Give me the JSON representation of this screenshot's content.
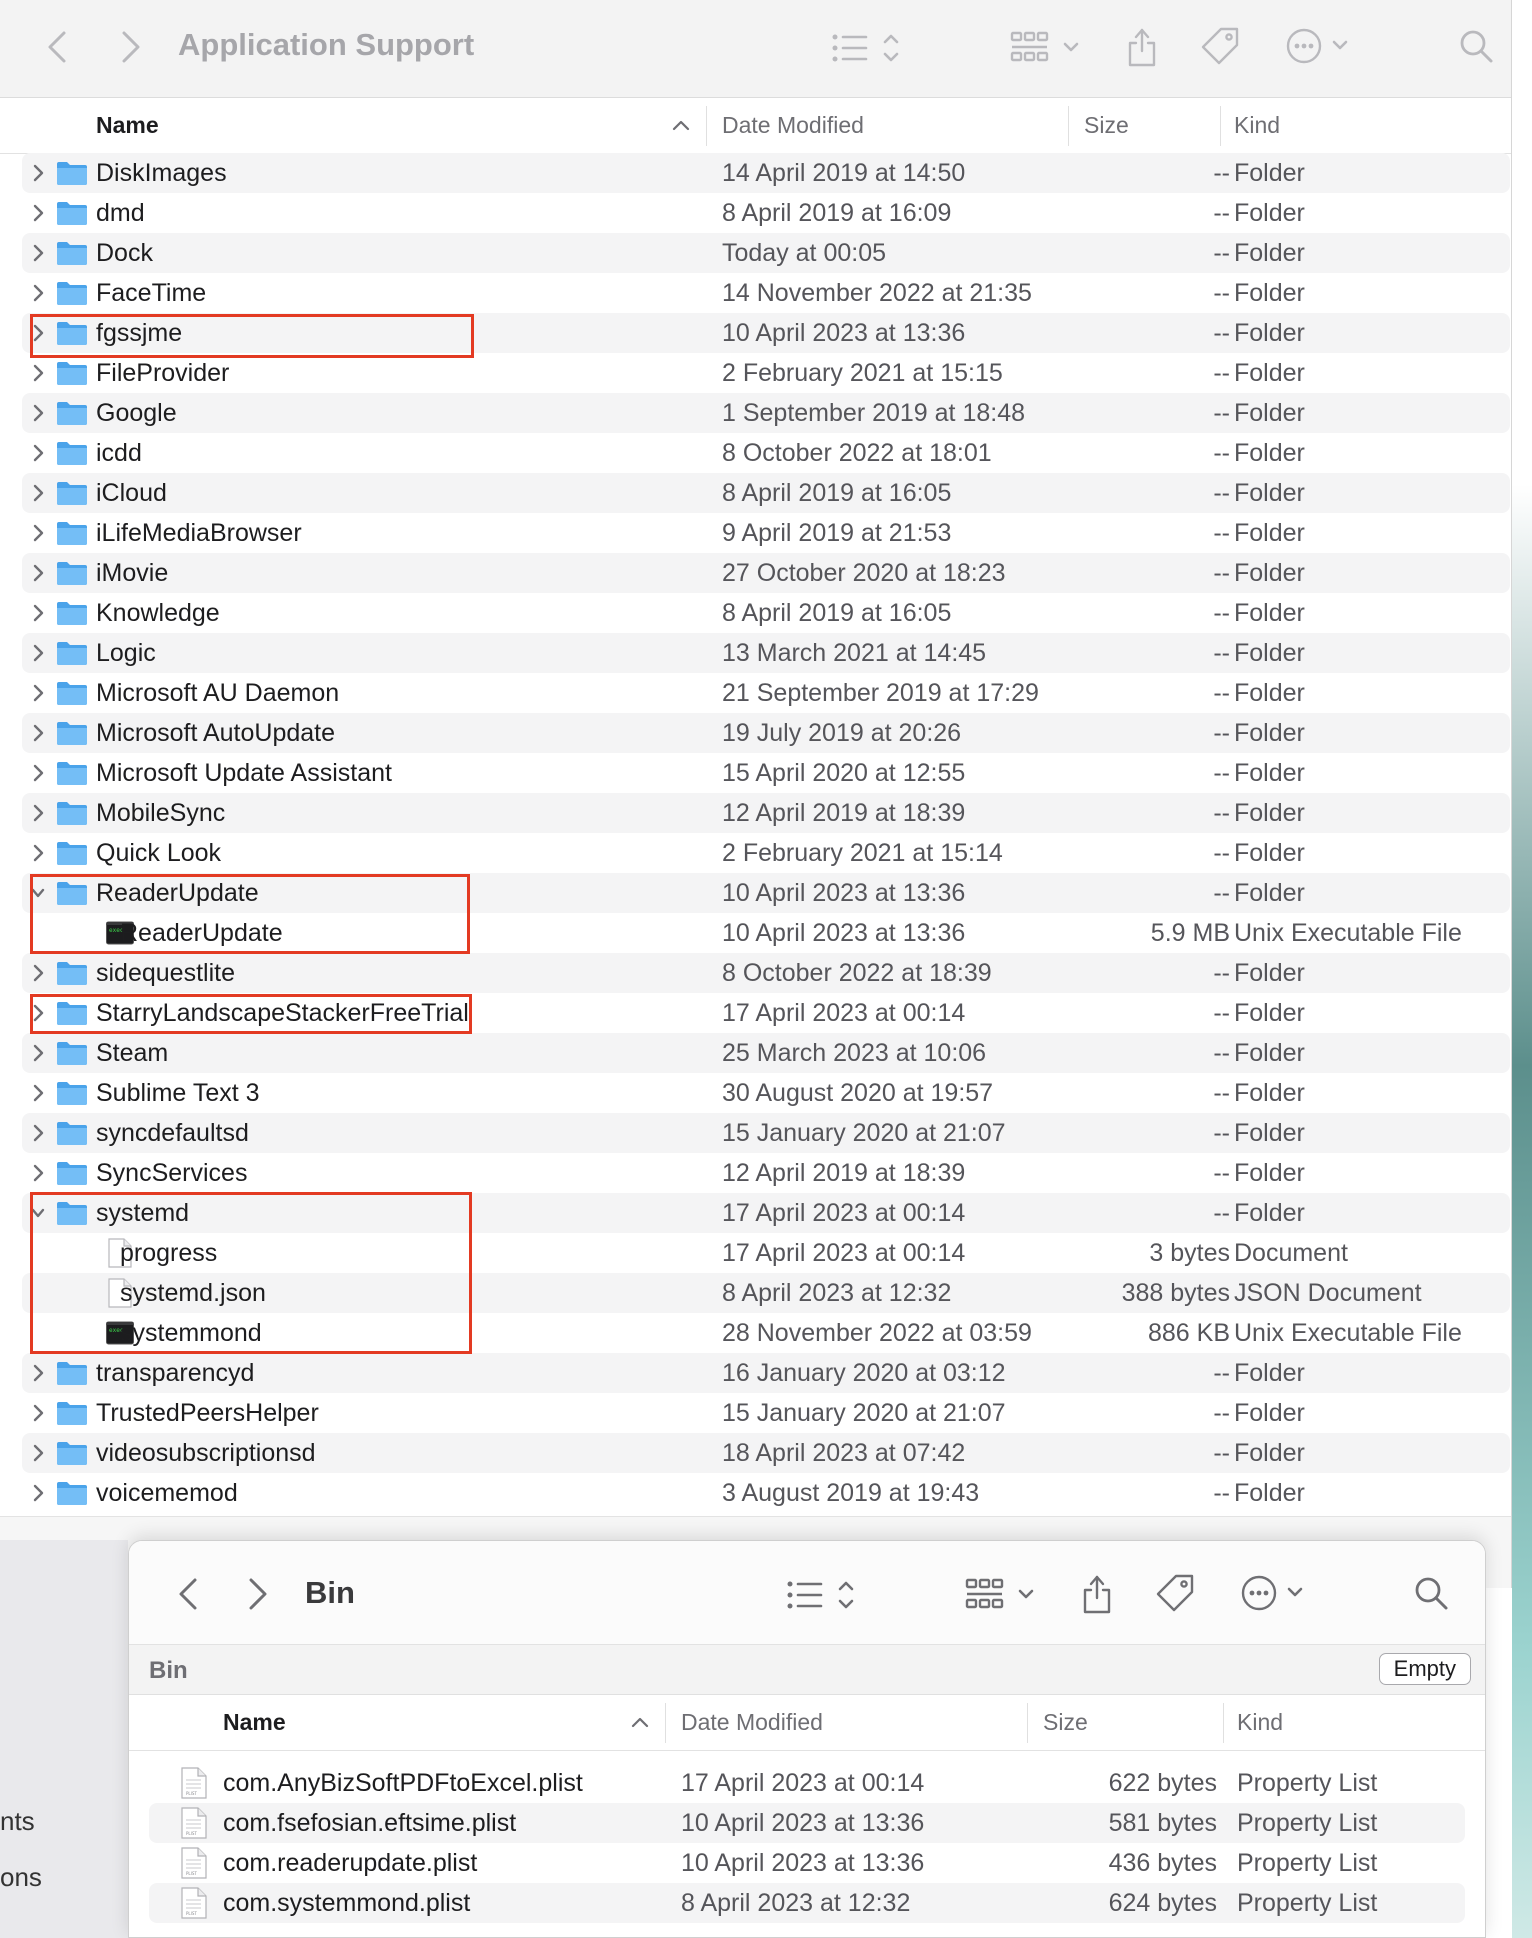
{
  "window1": {
    "title": "Application Support",
    "columns": {
      "name": "Name",
      "date": "Date Modified",
      "size": "Size",
      "kind": "Kind"
    },
    "rows": [
      {
        "name": "DiskImages",
        "date": "14 April 2019 at 14:50",
        "size": "--",
        "kind": "Folder",
        "type": "folder",
        "depth": 0,
        "expanded": false
      },
      {
        "name": "dmd",
        "date": "8 April 2019 at 16:09",
        "size": "--",
        "kind": "Folder",
        "type": "folder",
        "depth": 0,
        "expanded": false
      },
      {
        "name": "Dock",
        "date": "Today at 00:05",
        "size": "--",
        "kind": "Folder",
        "type": "folder",
        "depth": 0,
        "expanded": false
      },
      {
        "name": "FaceTime",
        "date": "14 November 2022 at 21:35",
        "size": "--",
        "kind": "Folder",
        "type": "folder",
        "depth": 0,
        "expanded": false
      },
      {
        "name": "fgssjme",
        "date": "10 April 2023 at 13:36",
        "size": "--",
        "kind": "Folder",
        "type": "folder",
        "depth": 0,
        "expanded": false
      },
      {
        "name": "FileProvider",
        "date": "2 February 2021 at 15:15",
        "size": "--",
        "kind": "Folder",
        "type": "folder",
        "depth": 0,
        "expanded": false
      },
      {
        "name": "Google",
        "date": "1 September 2019 at 18:48",
        "size": "--",
        "kind": "Folder",
        "type": "folder",
        "depth": 0,
        "expanded": false
      },
      {
        "name": "icdd",
        "date": "8 October 2022 at 18:01",
        "size": "--",
        "kind": "Folder",
        "type": "folder",
        "depth": 0,
        "expanded": false
      },
      {
        "name": "iCloud",
        "date": "8 April 2019 at 16:05",
        "size": "--",
        "kind": "Folder",
        "type": "folder",
        "depth": 0,
        "expanded": false
      },
      {
        "name": "iLifeMediaBrowser",
        "date": "9 April 2019 at 21:53",
        "size": "--",
        "kind": "Folder",
        "type": "folder",
        "depth": 0,
        "expanded": false
      },
      {
        "name": "iMovie",
        "date": "27 October 2020 at 18:23",
        "size": "--",
        "kind": "Folder",
        "type": "folder",
        "depth": 0,
        "expanded": false
      },
      {
        "name": "Knowledge",
        "date": "8 April 2019 at 16:05",
        "size": "--",
        "kind": "Folder",
        "type": "folder",
        "depth": 0,
        "expanded": false
      },
      {
        "name": "Logic",
        "date": "13 March 2021 at 14:45",
        "size": "--",
        "kind": "Folder",
        "type": "folder",
        "depth": 0,
        "expanded": false
      },
      {
        "name": "Microsoft AU Daemon",
        "date": "21 September 2019 at 17:29",
        "size": "--",
        "kind": "Folder",
        "type": "folder",
        "depth": 0,
        "expanded": false
      },
      {
        "name": "Microsoft AutoUpdate",
        "date": "19 July 2019 at 20:26",
        "size": "--",
        "kind": "Folder",
        "type": "folder",
        "depth": 0,
        "expanded": false
      },
      {
        "name": "Microsoft Update Assistant",
        "date": "15 April 2020 at 12:55",
        "size": "--",
        "kind": "Folder",
        "type": "folder",
        "depth": 0,
        "expanded": false
      },
      {
        "name": "MobileSync",
        "date": "12 April 2019 at 18:39",
        "size": "--",
        "kind": "Folder",
        "type": "folder",
        "depth": 0,
        "expanded": false
      },
      {
        "name": "Quick Look",
        "date": "2 February 2021 at 15:14",
        "size": "--",
        "kind": "Folder",
        "type": "folder",
        "depth": 0,
        "expanded": false
      },
      {
        "name": "ReaderUpdate",
        "date": "10 April 2023 at 13:36",
        "size": "--",
        "kind": "Folder",
        "type": "folder",
        "depth": 0,
        "expanded": true
      },
      {
        "name": "ReaderUpdate",
        "date": "10 April 2023 at 13:36",
        "size": "5.9 MB",
        "kind": "Unix Executable File",
        "type": "exec",
        "depth": 1,
        "expanded": false
      },
      {
        "name": "sidequestlite",
        "date": "8 October 2022 at 18:39",
        "size": "--",
        "kind": "Folder",
        "type": "folder",
        "depth": 0,
        "expanded": false
      },
      {
        "name": "StarryLandscapeStackerFreeTrial",
        "date": "17 April 2023 at 00:14",
        "size": "--",
        "kind": "Folder",
        "type": "folder",
        "depth": 0,
        "expanded": false
      },
      {
        "name": "Steam",
        "date": "25 March 2023 at 10:06",
        "size": "--",
        "kind": "Folder",
        "type": "folder",
        "depth": 0,
        "expanded": false
      },
      {
        "name": "Sublime Text 3",
        "date": "30 August 2020 at 19:57",
        "size": "--",
        "kind": "Folder",
        "type": "folder",
        "depth": 0,
        "expanded": false
      },
      {
        "name": "syncdefaultsd",
        "date": "15 January 2020 at 21:07",
        "size": "--",
        "kind": "Folder",
        "type": "folder",
        "depth": 0,
        "expanded": false
      },
      {
        "name": "SyncServices",
        "date": "12 April 2019 at 18:39",
        "size": "--",
        "kind": "Folder",
        "type": "folder",
        "depth": 0,
        "expanded": false
      },
      {
        "name": "systemd",
        "date": "17 April 2023 at 00:14",
        "size": "--",
        "kind": "Folder",
        "type": "folder",
        "depth": 0,
        "expanded": true
      },
      {
        "name": "progress",
        "date": "17 April 2023 at 00:14",
        "size": "3 bytes",
        "kind": "Document",
        "type": "doc",
        "depth": 1,
        "expanded": false
      },
      {
        "name": "systemd.json",
        "date": "8 April 2023 at 12:32",
        "size": "388 bytes",
        "kind": "JSON Document",
        "type": "doc",
        "depth": 1,
        "expanded": false
      },
      {
        "name": "systemmond",
        "date": "28 November 2022 at 03:59",
        "size": "886 KB",
        "kind": "Unix Executable File",
        "type": "exec",
        "depth": 1,
        "expanded": false
      },
      {
        "name": "transparencyd",
        "date": "16 January 2020 at 03:12",
        "size": "--",
        "kind": "Folder",
        "type": "folder",
        "depth": 0,
        "expanded": false
      },
      {
        "name": "TrustedPeersHelper",
        "date": "15 January 2020 at 21:07",
        "size": "--",
        "kind": "Folder",
        "type": "folder",
        "depth": 0,
        "expanded": false
      },
      {
        "name": "videosubscriptionsd",
        "date": "18 April 2023 at 07:42",
        "size": "--",
        "kind": "Folder",
        "type": "folder",
        "depth": 0,
        "expanded": false
      },
      {
        "name": "voicememod",
        "date": "3 August 2019 at 19:43",
        "size": "--",
        "kind": "Folder",
        "type": "folder",
        "depth": 0,
        "expanded": false
      }
    ]
  },
  "window2": {
    "title": "Bin",
    "path_label": "Bin",
    "empty_button": "Empty",
    "columns": {
      "name": "Name",
      "date": "Date Modified",
      "size": "Size",
      "kind": "Kind"
    },
    "rows": [
      {
        "name": "com.AnyBizSoftPDFtoExcel.plist",
        "date": "17 April 2023 at 00:14",
        "size": "622 bytes",
        "kind": "Property List"
      },
      {
        "name": "com.fsefosian.eftsime.plist",
        "date": "10 April 2023 at 13:36",
        "size": "581 bytes",
        "kind": "Property List"
      },
      {
        "name": "com.readerupdate.plist",
        "date": "10 April 2023 at 13:36",
        "size": "436 bytes",
        "kind": "Property List"
      },
      {
        "name": "com.systemmond.plist",
        "date": "8 April 2023 at 12:32",
        "size": "624 bytes",
        "kind": "Property List"
      }
    ]
  },
  "sidebar_fragments": [
    "nts",
    "ons"
  ],
  "colors": {
    "highlight": "#e33a22",
    "folder": "#5aaef0",
    "accent": "#1d1d1f"
  }
}
